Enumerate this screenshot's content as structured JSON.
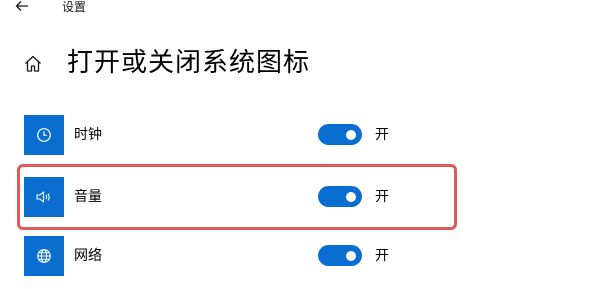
{
  "window": {
    "title": "设置"
  },
  "page": {
    "title": "打开或关闭系统图标"
  },
  "colors": {
    "accent": "#0a6ed1",
    "highlight": "#e05a5a"
  },
  "items": [
    {
      "label": "时钟",
      "icon": "clock-icon",
      "toggle_state": "开",
      "on": true
    },
    {
      "label": "音量",
      "icon": "volume-icon",
      "toggle_state": "开",
      "on": true
    },
    {
      "label": "网络",
      "icon": "network-globe-icon",
      "toggle_state": "开",
      "on": true
    }
  ]
}
